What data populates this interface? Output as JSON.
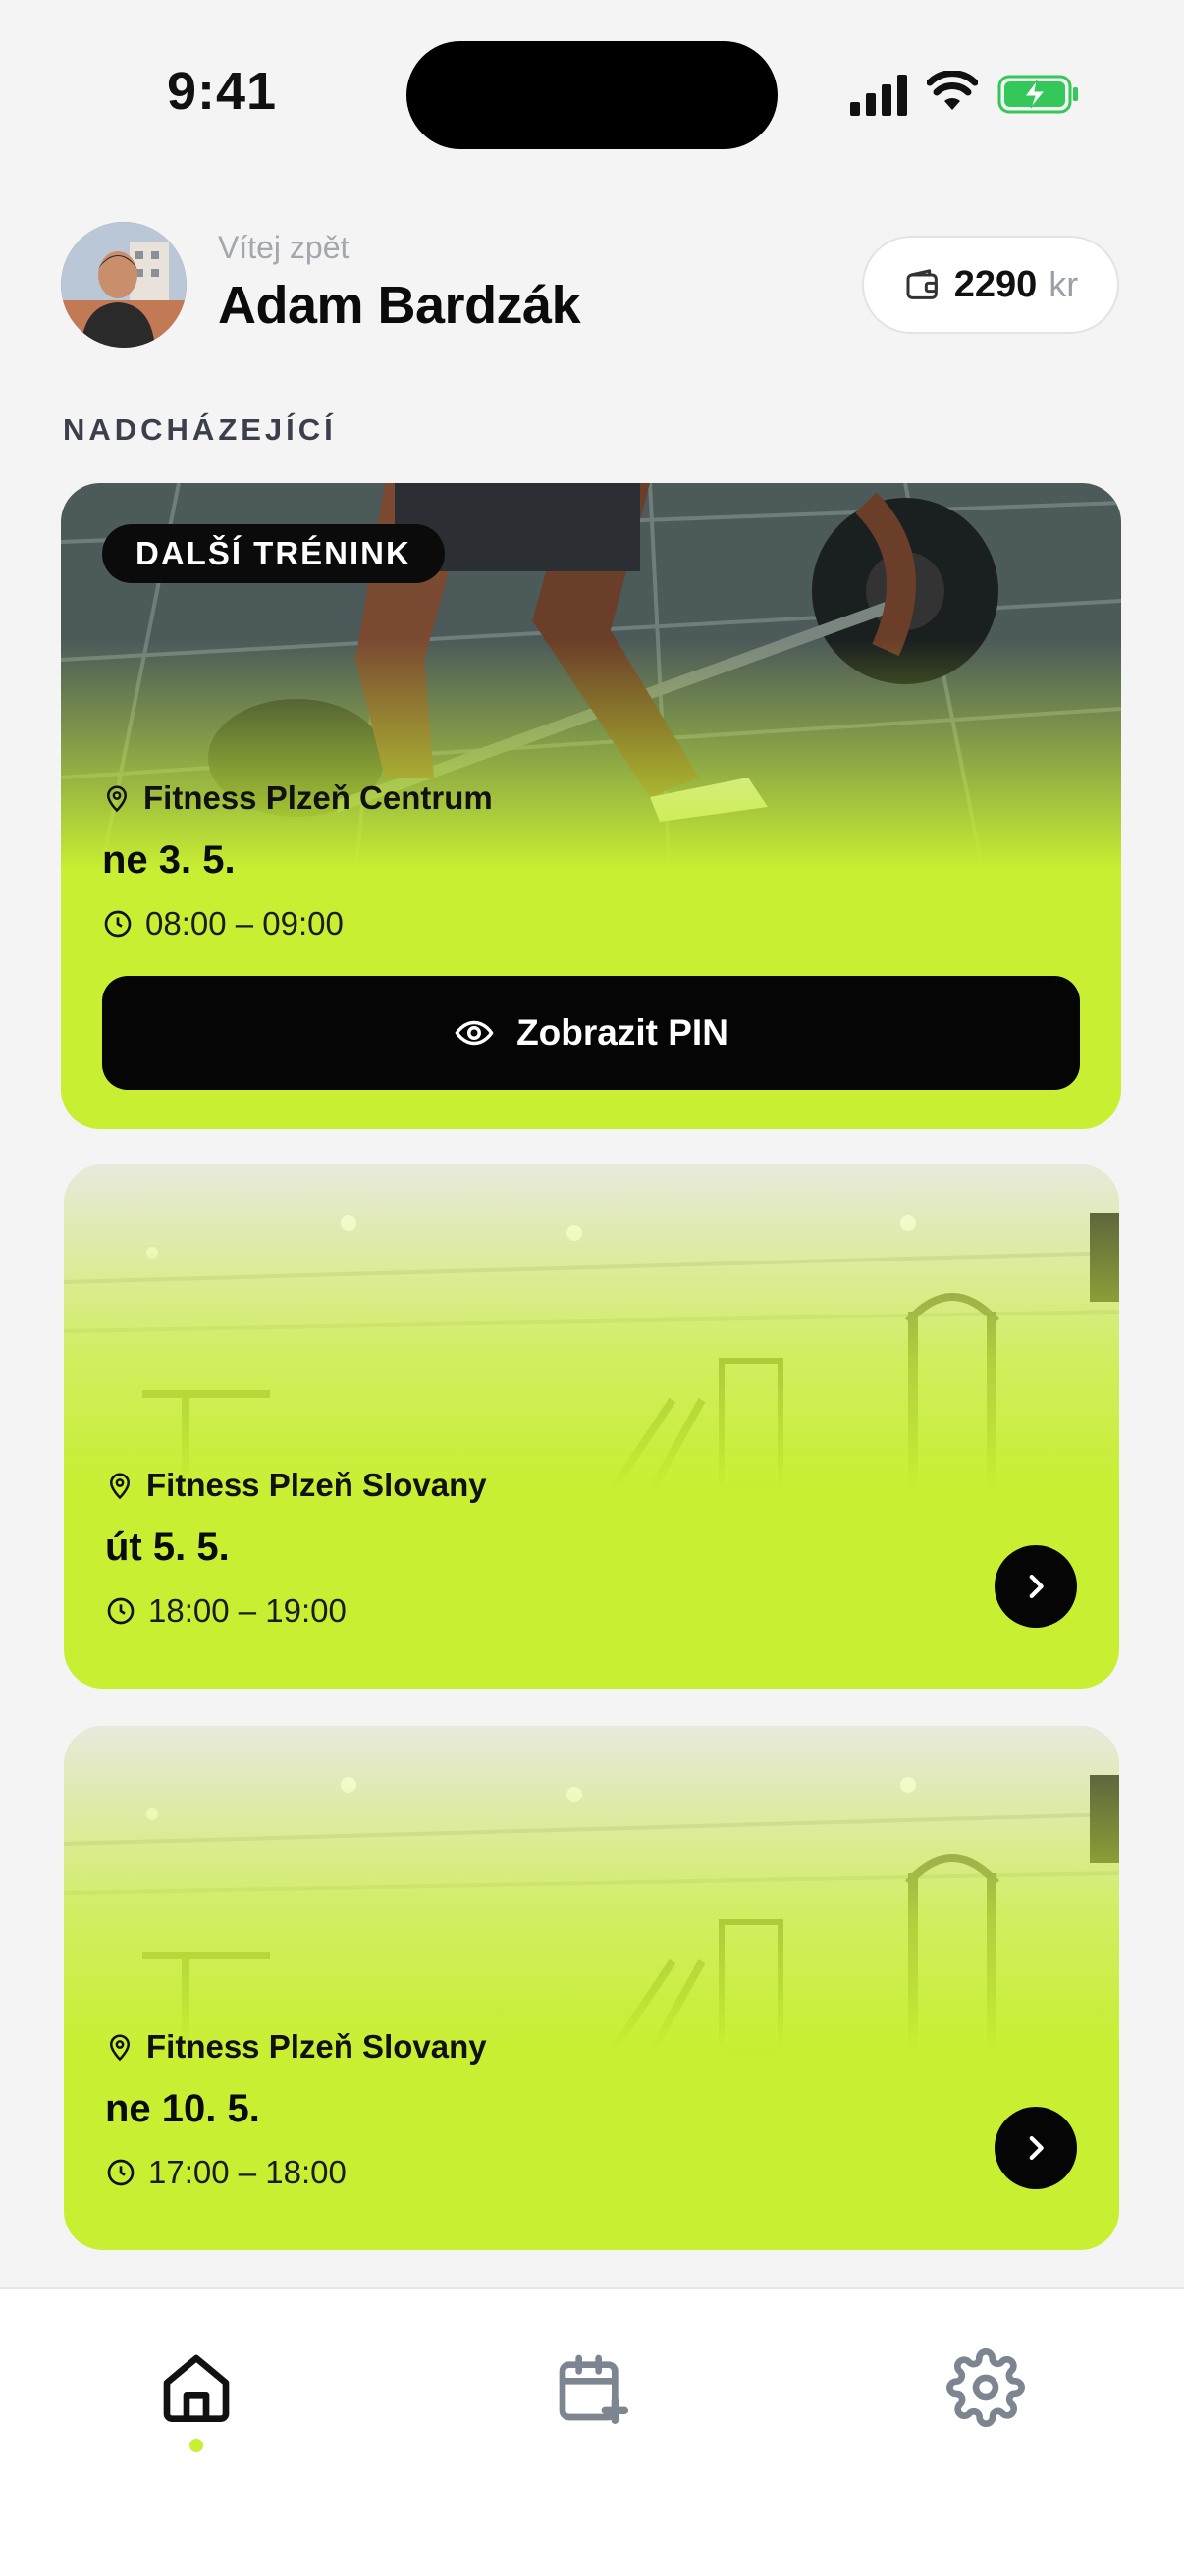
{
  "status_bar": {
    "time": "9:41"
  },
  "header": {
    "welcome": "Vítej zpět",
    "user_name": "Adam Bardzák",
    "wallet_amount": "2290",
    "wallet_currency": "kr"
  },
  "section_title": "NADCHÁZEJÍCÍ",
  "next_training": {
    "badge": "DALŠÍ TRÉNINK",
    "location": "Fitness Plzeň Centrum",
    "date": "ne 3. 5.",
    "time": "08:00 – 09:00",
    "pin_button": "Zobrazit PIN"
  },
  "upcoming": [
    {
      "location": "Fitness Plzeň Slovany",
      "date": "út 5. 5.",
      "time": "18:00 – 19:00"
    },
    {
      "location": "Fitness Plzeň Slovany",
      "date": "ne 10. 5.",
      "time": "17:00 – 18:00"
    }
  ],
  "tabs": [
    {
      "icon": "home-icon",
      "active": true
    },
    {
      "icon": "calendar-plus-icon",
      "active": false
    },
    {
      "icon": "gear-icon",
      "active": false
    }
  ],
  "colors": {
    "accent": "#c8ef32",
    "background": "#f4f4f4",
    "dark": "#050505"
  }
}
